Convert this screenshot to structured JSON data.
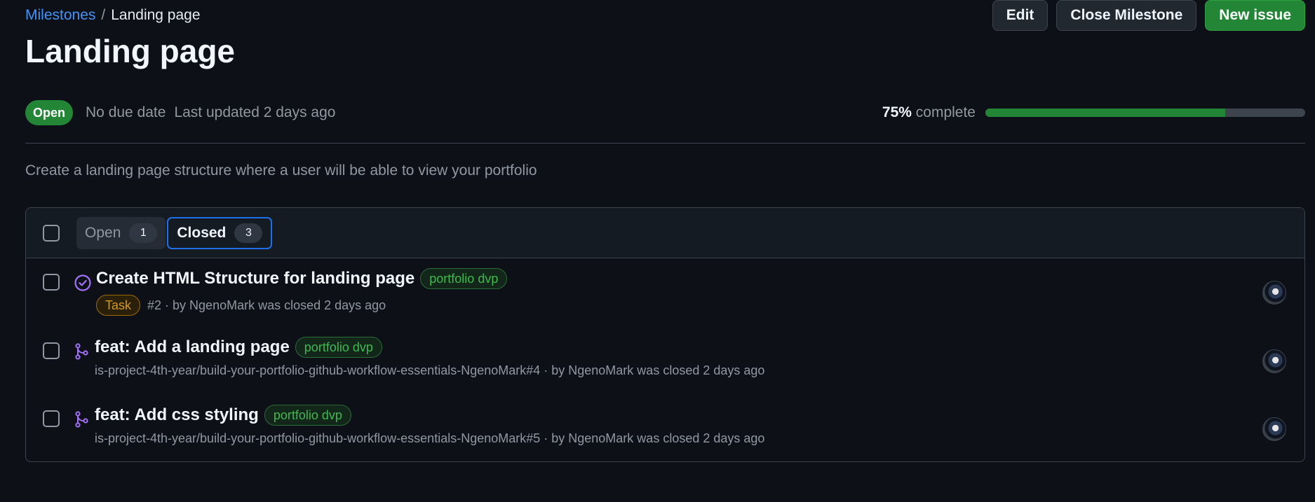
{
  "breadcrumb": {
    "parent": "Milestones",
    "separator": "/",
    "current": "Landing page"
  },
  "actions": {
    "edit": "Edit",
    "close_milestone": "Close Milestone",
    "new_issue": "New issue"
  },
  "milestone": {
    "title": "Landing page",
    "state": "Open",
    "due": "No due date",
    "updated": "Last updated 2 days ago",
    "percent_label": "75%",
    "complete_label": "complete",
    "progress_fraction": 0.75,
    "description": "Create a landing page structure where a user will be able to view your portfolio"
  },
  "tabs": [
    {
      "label": "Open",
      "count": "1",
      "selected": false
    },
    {
      "label": "Closed",
      "count": "3",
      "selected": true
    }
  ],
  "issues": [
    {
      "title": "Create HTML Structure for landing page",
      "label": "portfolio dvp",
      "type": "Task",
      "meta": "#2 · by NgenoMark was closed 2 days ago",
      "icon": "issue-closed-icon"
    },
    {
      "title": "feat: Add a landing page",
      "label": "portfolio dvp",
      "meta": "is-project-4th-year/build-your-portfolio-github-workflow-essentials-NgenoMark#4 · by NgenoMark was closed 2 days ago",
      "icon": "pull-request-merged-icon"
    },
    {
      "title": "feat: Add css styling",
      "label": "portfolio dvp",
      "meta": "is-project-4th-year/build-your-portfolio-github-workflow-essentials-NgenoMark#5 · by NgenoMark was closed 2 days ago",
      "icon": "pull-request-merged-icon"
    }
  ],
  "colors": {
    "background": "#0d1117",
    "accent_link": "#4493f8",
    "success": "#238636",
    "merged_purple": "#a371f7",
    "label_green": "#3fb950",
    "task_orange": "#d29922"
  }
}
